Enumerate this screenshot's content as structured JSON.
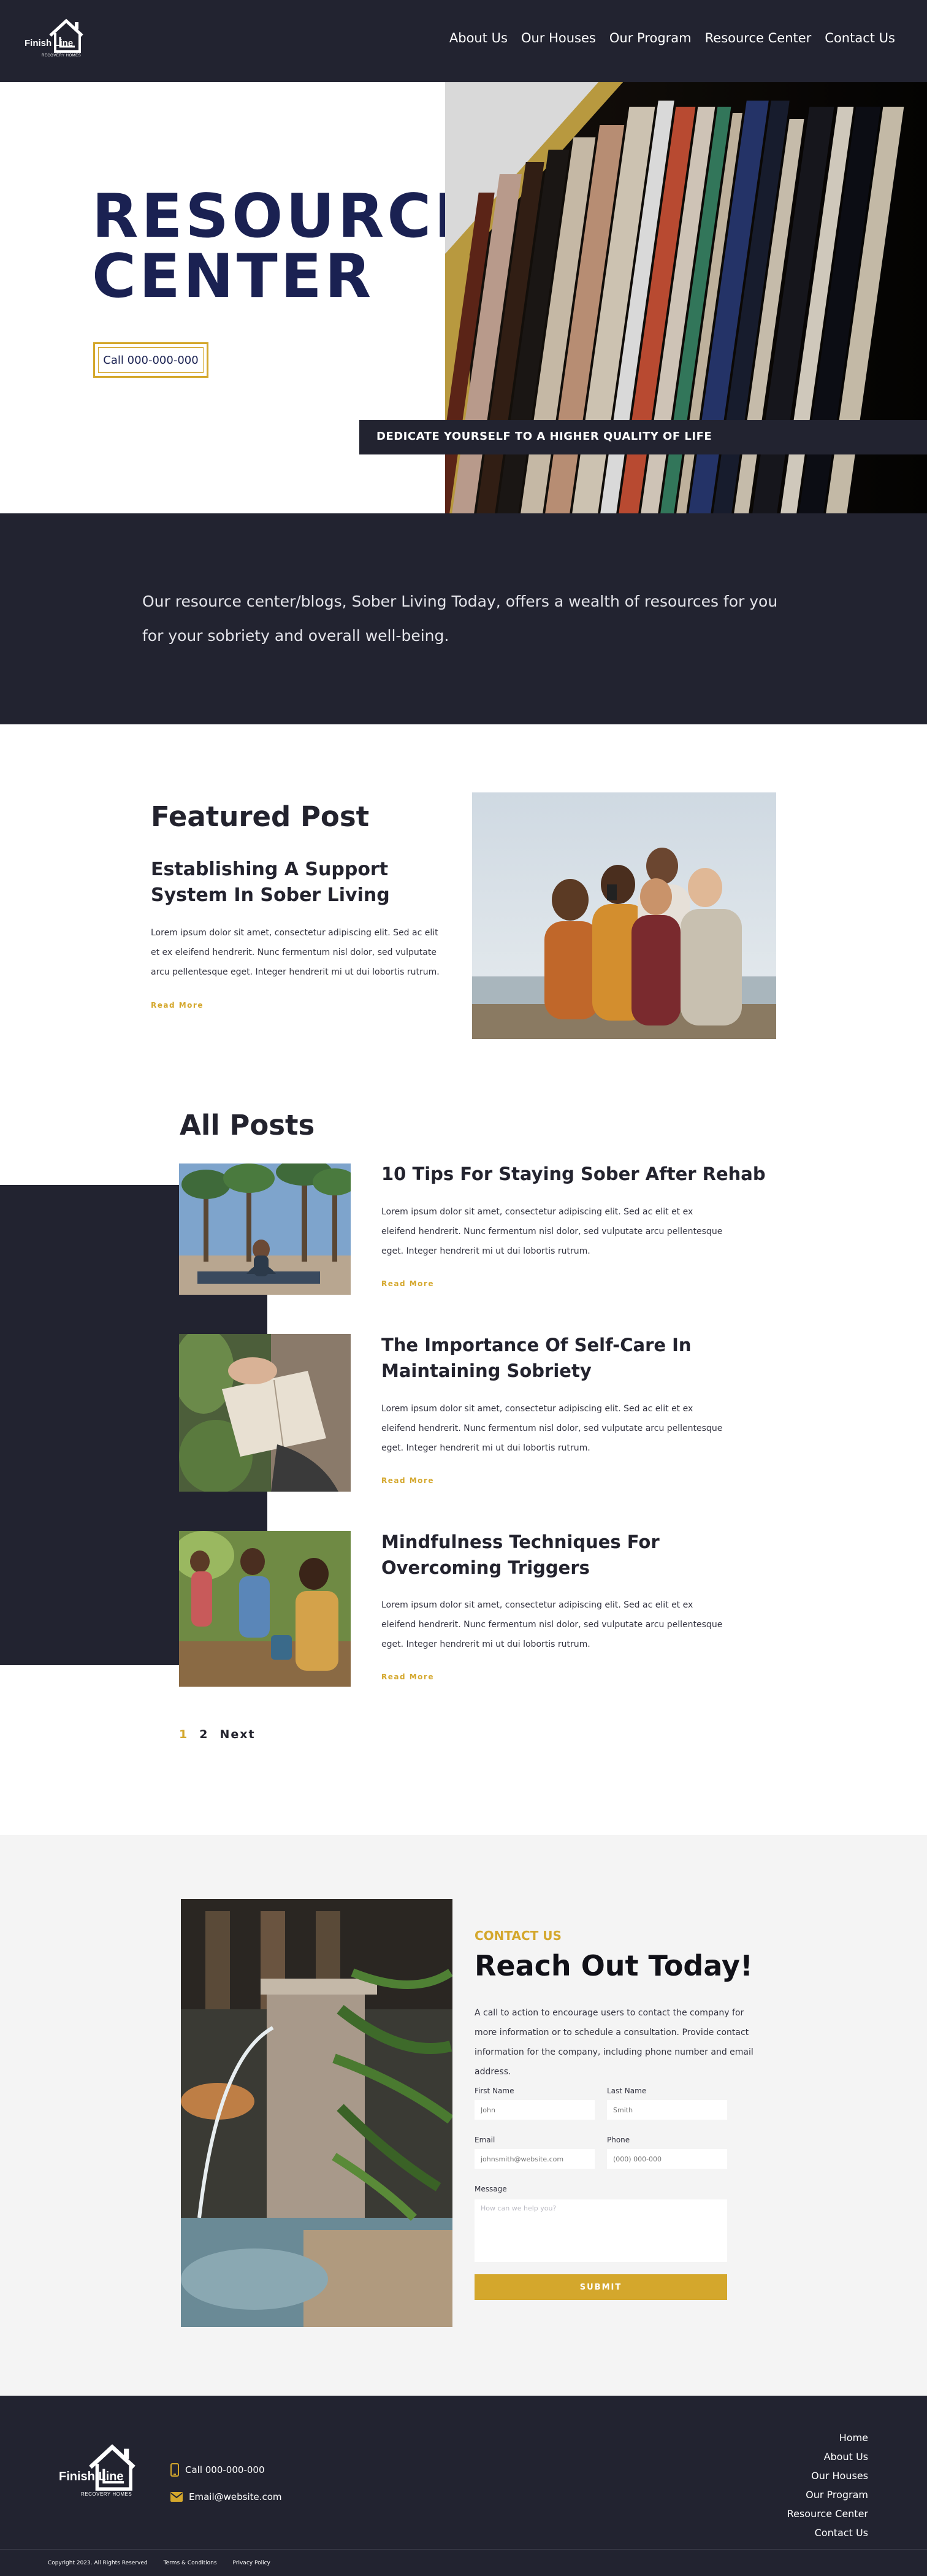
{
  "brand": {
    "name": "Finish Line",
    "tagline": "RECOVERY HOMES"
  },
  "nav": {
    "items": [
      "About Us",
      "Our Houses",
      "Our Program",
      "Resource Center",
      "Contact Us"
    ]
  },
  "hero": {
    "title_line1": "RESOURCE",
    "title_line2": "CENTER",
    "call_button": "Call 000-000-000",
    "banner": "DEDICATE YOURSELF TO A HIGHER QUALITY OF LIFE"
  },
  "intro": {
    "text": "Our resource center/blogs, Sober Living Today, offers a wealth of resources for you for your sobriety and overall well-being."
  },
  "featured": {
    "heading": "Featured Post",
    "title": "Establishing A Support System In Sober Living",
    "excerpt": "Lorem ipsum dolor sit amet, consectetur adipiscing elit. Sed ac elit et ex eleifend hendrerit. Nunc fermentum nisl dolor, sed vulputate arcu pellentesque eget. Integer hendrerit mi ut dui lobortis rutrum.",
    "read_more": "Read More"
  },
  "all_posts": {
    "heading": "All Posts",
    "posts": [
      {
        "title": "10 Tips For Staying Sober After Rehab",
        "excerpt": "Lorem ipsum dolor sit amet, consectetur adipiscing elit. Sed ac elit et ex eleifend hendrerit. Nunc fermentum nisl dolor, sed vulputate arcu pellentesque eget. Integer hendrerit mi ut dui lobortis rutrum.",
        "read_more": "Read More"
      },
      {
        "title": "The Importance Of Self-Care In Maintaining Sobriety",
        "excerpt": "Lorem ipsum dolor sit amet, consectetur adipiscing elit. Sed ac elit et ex eleifend hendrerit. Nunc fermentum nisl dolor, sed vulputate arcu pellentesque eget. Integer hendrerit mi ut dui lobortis rutrum.",
        "read_more": "Read More"
      },
      {
        "title": "Mindfulness Techniques For Overcoming Triggers",
        "excerpt": "Lorem ipsum dolor sit amet, consectetur adipiscing elit. Sed ac elit et ex eleifend hendrerit. Nunc fermentum nisl dolor, sed vulputate arcu pellentesque eget. Integer hendrerit mi ut dui lobortis rutrum.",
        "read_more": "Read More"
      }
    ],
    "pagination": {
      "current": "1",
      "page2": "2",
      "next": "Next"
    }
  },
  "contact": {
    "eyebrow": "CONTACT US",
    "title": "Reach Out Today!",
    "text": "A call to action to encourage users to contact the company for more information or to schedule a consultation. Provide contact information for the company, including phone number and email address.",
    "form": {
      "first_name_label": "First Name",
      "first_name_placeholder": "John",
      "last_name_label": "Last Name",
      "last_name_placeholder": "Smith",
      "email_label": "Email",
      "email_placeholder": "johnsmith@website.com",
      "phone_label": "Phone",
      "phone_placeholder": "(000) 000-000",
      "message_label": "Message",
      "message_placeholder": "How can we help you?",
      "submit": "SUBMIT"
    }
  },
  "footer": {
    "phone": "Call 000-000-000",
    "email": "Email@website.com",
    "links": [
      "Home",
      "About Us",
      "Our Houses",
      "Our Program",
      "Resource Center",
      "Contact Us"
    ],
    "copyright": "Copyright 2023. All Rights Reserved",
    "terms": "Terms & Conditions",
    "privacy": "Privacy Policy"
  },
  "colors": {
    "dark": "#222330",
    "accent": "#d4a72c",
    "navy": "#1a2152",
    "light_bg": "#f4f4f4"
  }
}
